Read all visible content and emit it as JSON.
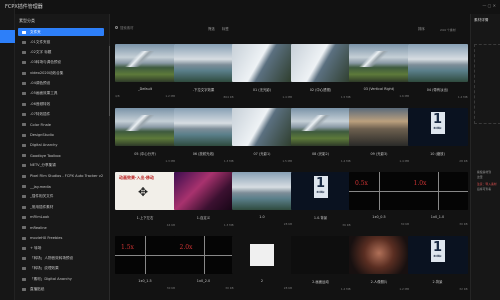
{
  "app": {
    "title": "FCPX插件管理器"
  },
  "rail": {
    "items": [
      "",
      "",
      "",
      "",
      ""
    ]
  },
  "categories": {
    "heading": "素型分类",
    "items": [
      {
        "label": "文件夹",
        "badge": ""
      },
      {
        "label": "-01文件夹链",
        "badge": ""
      },
      {
        "label": "-02文字 标题",
        "badge": ""
      },
      {
        "label": "-03转场与调色预设",
        "badge": ""
      },
      {
        "label": "video2020动效合集",
        "badge": ""
      },
      {
        "label": "-04调色预设",
        "badge": ""
      },
      {
        "label": "-05画面效果工具",
        "badge": ""
      },
      {
        "label": "-06音频特效",
        "badge": ""
      },
      {
        "label": "-07特效插件",
        "badge": ""
      },
      {
        "label": "Color Finale",
        "badge": ""
      },
      {
        "label": "DesignStudio",
        "badge": ""
      },
      {
        "label": "Digital Anarchy",
        "badge": ""
      },
      {
        "label": "Goodbye Toolbox",
        "badge": ""
      },
      {
        "label": "NETV_分享集锦",
        "badge": ""
      },
      {
        "label": "Pixel Film Studios - FCPX Auto Tracker v2",
        "badge": ""
      },
      {
        "label": "__Jay.media",
        "badge": ""
      },
      {
        "label": "_插件相关文件",
        "badge": ""
      },
      {
        "label": "_常用插件素材",
        "badge": ""
      },
      {
        "label": "mFilmLook",
        "badge": ""
      },
      {
        "label": "mRealine",
        "badge": ""
      },
      {
        "label": "movieHX Freebies",
        "badge": ""
      },
      {
        "label": "+ 转场",
        "badge": ""
      },
      {
        "label": "「转场」人物音效转场预设",
        "badge": ""
      },
      {
        "label": "「转场」纹理效果",
        "badge": ""
      },
      {
        "label": "「素材」Digital Anarchy",
        "badge": ""
      },
      {
        "label": "直播贴纸",
        "badge": ""
      }
    ]
  },
  "toolbar": {
    "search_placeholder": "搜索素材",
    "filter_label": "筛选",
    "tag_label": "标签",
    "sort_label": "排序",
    "count_label": "244 个素材"
  },
  "grid": {
    "items": [
      {
        "name": "_Default",
        "size": "1.2 MB",
        "count": "4/8",
        "thumb": "t-mtn"
      },
      {
        "name": "-下拉文字效果",
        "size": "864 KB",
        "count": "",
        "thumb": "t-lake"
      },
      {
        "name": "01 (无光影)",
        "size": "1.4 MB",
        "count": "",
        "thumb": "t-wipe"
      },
      {
        "name": "02 (中心透视)",
        "size": "1.5 MB",
        "count": "",
        "thumb": "t-wipe"
      },
      {
        "name": "03 (Vertical Right)",
        "size": "1.6 MB",
        "count": "",
        "thumb": "t-mtn"
      },
      {
        "name": "04 (带有淡出)",
        "size": "1.4 MB",
        "count": "",
        "thumb": "t-lake"
      },
      {
        "name": "05 (中心分开)",
        "size": "1.3 MB",
        "count": "",
        "thumb": "t-mtn"
      },
      {
        "name": "06 (放射光线)",
        "size": "1.3 MB",
        "count": "",
        "thumb": "t-lake"
      },
      {
        "name": "07 (光影1)",
        "size": "1.5 MB",
        "count": "",
        "thumb": "t-wipe"
      },
      {
        "name": "08 (光影2)",
        "size": "1.4 MB",
        "count": "",
        "thumb": "t-mtn"
      },
      {
        "name": "09 (光影3)",
        "size": "1.4 MB",
        "count": "",
        "thumb": "t-dusk"
      },
      {
        "name": "10 (缩放)",
        "size": "28 KB",
        "count": "",
        "thumb": "t-num"
      },
      {
        "name": "1.上下左右",
        "size": "44 KB",
        "count": "",
        "thumb": "t-sign"
      },
      {
        "name": "1.自定义",
        "size": "1.3 MB",
        "count": "",
        "thumb": "t-concert"
      },
      {
        "name": "1.0",
        "size": "28 KB",
        "count": "",
        "thumb": "t-lake"
      },
      {
        "name": "1.0.背景",
        "size": "36 KB",
        "count": "",
        "thumb": "t-num"
      },
      {
        "name": "1x0_0.5",
        "size": "30 KB",
        "count": "",
        "thumb": "t-split"
      },
      {
        "name": "1x0_1.0",
        "size": "30 KB",
        "count": "",
        "thumb": "t-split"
      },
      {
        "name": "1x0_1.5",
        "size": "30 KB",
        "count": "",
        "thumb": "t-split"
      },
      {
        "name": "1x0_2.0",
        "size": "30 KB",
        "count": "",
        "thumb": "t-split"
      },
      {
        "name": "2",
        "size": "28 KB",
        "count": "",
        "thumb": "t-reel"
      },
      {
        "name": "2.画面运动",
        "size": "1.4 MB",
        "count": "",
        "thumb": "t-dark"
      },
      {
        "name": "2.人像照片",
        "size": "1.2 MB",
        "count": "",
        "thumb": "t-face"
      },
      {
        "name": "2.背景",
        "size": "32 KB",
        "count": "",
        "thumb": "t-num"
      }
    ],
    "split_labels": [
      "",
      "",
      "",
      "",
      "0.5x",
      "1.0x",
      "1.5x",
      "2.0x"
    ]
  },
  "sign": {
    "text": "动画效果·入出·移动"
  },
  "num_tiles": {
    "digit": "1",
    "caption": "素材图标"
  },
  "right": {
    "heading": "素材详情",
    "line1": "拖拽素材到",
    "line2": "这里",
    "line3_red": "注意：导入素材",
    "line4": "后将可查看"
  }
}
